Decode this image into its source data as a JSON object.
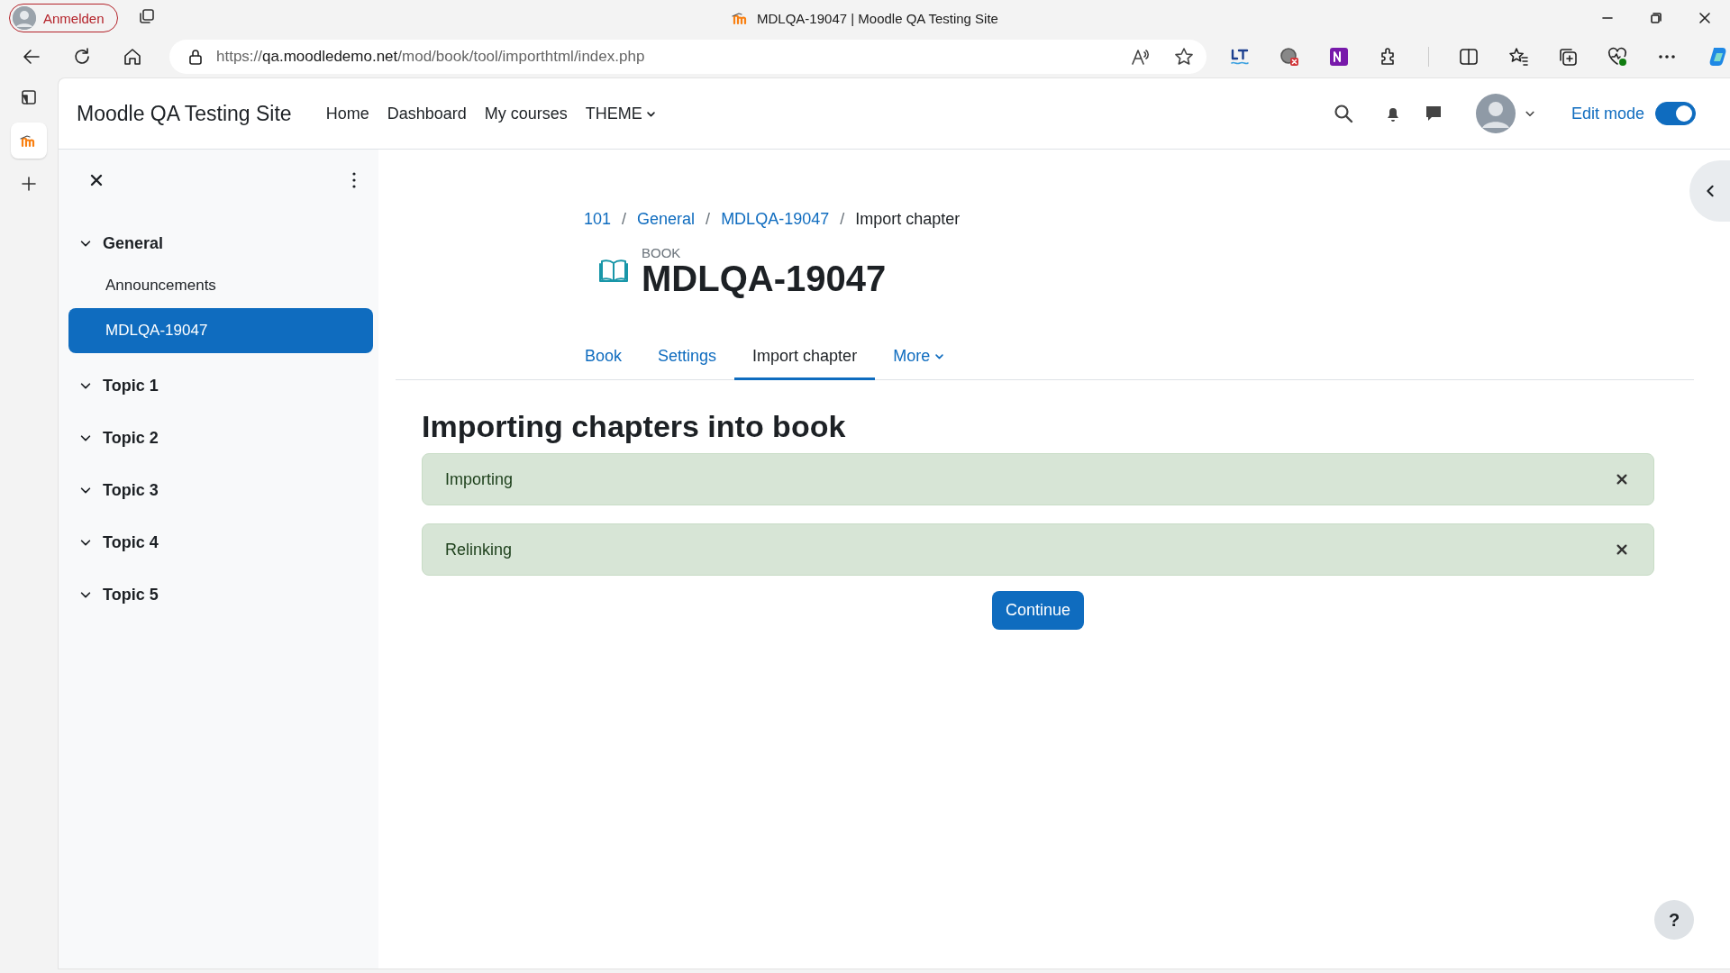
{
  "browser": {
    "profile_button": "Anmelden",
    "tab_title": "MDLQA-19047 | Moodle QA Testing Site",
    "url_scheme": "https://",
    "url_host": "qa.moodledemo.net",
    "url_path": "/mod/book/tool/importhtml/index.php"
  },
  "navbar": {
    "site_name": "Moodle QA Testing Site",
    "items": [
      {
        "label": "Home",
        "dropdown": false
      },
      {
        "label": "Dashboard",
        "dropdown": false
      },
      {
        "label": "My courses",
        "dropdown": false
      },
      {
        "label": "THEME",
        "dropdown": true
      }
    ],
    "edit_mode": {
      "label": "Edit mode",
      "on": true
    }
  },
  "course_index": {
    "sections": [
      {
        "title": "General",
        "expanded": true,
        "children": [
          {
            "label": "Announcements",
            "selected": false
          },
          {
            "label": "MDLQA-19047",
            "selected": true
          }
        ]
      },
      {
        "title": "Topic 1",
        "expanded": true
      },
      {
        "title": "Topic 2",
        "expanded": true
      },
      {
        "title": "Topic 3",
        "expanded": true
      },
      {
        "title": "Topic 4",
        "expanded": true
      },
      {
        "title": "Topic 5",
        "expanded": true
      }
    ]
  },
  "breadcrumb": [
    {
      "label": "101",
      "link": true
    },
    {
      "separator": "/",
      "label": "General",
      "link": true
    },
    {
      "separator": "/",
      "label": "MDLQA-19047",
      "link": true
    },
    {
      "separator": "/",
      "label": "Import chapter",
      "link": false
    }
  ],
  "activity": {
    "type_label": "BOOK",
    "title": "MDLQA-19047"
  },
  "tabs": [
    {
      "label": "Book",
      "selected": false,
      "dropdown": false
    },
    {
      "label": "Settings",
      "selected": false,
      "dropdown": false
    },
    {
      "label": "Import chapter",
      "selected": true,
      "dropdown": false
    },
    {
      "label": "More",
      "selected": false,
      "dropdown": true
    }
  ],
  "heading": "Importing chapters into book",
  "alerts": [
    {
      "message": "Importing"
    },
    {
      "message": "Relinking"
    }
  ],
  "continue_button": "Continue",
  "help_button": "?"
}
